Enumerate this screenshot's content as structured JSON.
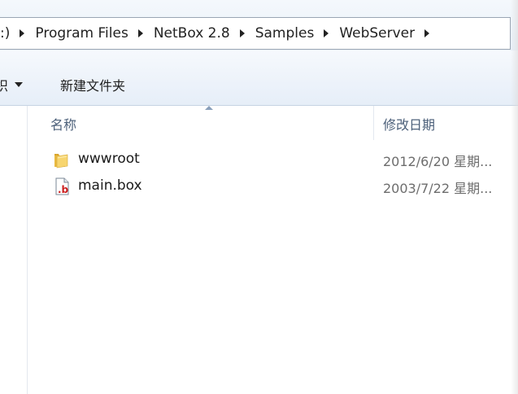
{
  "address": {
    "crumbs": [
      ":)",
      "Program Files",
      "NetBox 2.8",
      "Samples",
      "WebServer"
    ]
  },
  "toolbar": {
    "organize_label": "组织",
    "organize_visible": "织",
    "new_folder_label": "新建文件夹"
  },
  "columns": {
    "name_label": "名称",
    "date_label": "修改日期"
  },
  "files": [
    {
      "name": "wwwroot",
      "date": "2012/6/20 星期...",
      "icon": "folder-icon"
    },
    {
      "name": "main.box",
      "date": "2003/7/22 星期...",
      "icon": "box-file-icon"
    }
  ]
}
